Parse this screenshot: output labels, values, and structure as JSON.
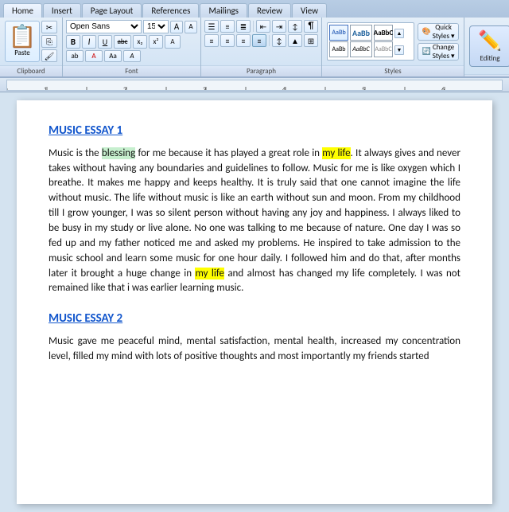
{
  "tabs": [
    {
      "label": "Home"
    },
    {
      "label": "Insert"
    },
    {
      "label": "Page Layout"
    },
    {
      "label": "References"
    },
    {
      "label": "Mailings"
    },
    {
      "label": "Review"
    },
    {
      "label": "View"
    }
  ],
  "font": {
    "name": "Open Sans",
    "size": "15",
    "bold": "B",
    "italic": "I",
    "underline": "U",
    "strikethrough": "abc",
    "subscript": "x₂",
    "superscript": "x²",
    "grow": "A",
    "shrink": "A",
    "clear": "A",
    "case": "Aa",
    "highlight": "A"
  },
  "groups": {
    "clipboard": "Clipboard",
    "font": "Font",
    "paragraph": "Paragraph",
    "styles": "Styles",
    "editing": "Editing"
  },
  "styles": {
    "quick_label": "Quick\nStyles ▾",
    "change_label": "Change\nStyles ▾"
  },
  "editing": {
    "label": "Editing"
  },
  "essay1": {
    "title": "MUSIC ESSAY 1",
    "body": "Music is the blessing for me because it has played a great role in my life. It always gives and never takes without having any boundaries and guidelines to follow. Music for me is like oxygen which I breathe. It makes me happy and keeps healthy. It is truly said that one cannot imagine the life without music. The life without music is like an earth without sun and moon. From my childhood till I grow younger, I was so silent person without having any joy and happiness. I always liked to be busy in my study or live alone. No one was talking to me because of nature. One day I was so fed up and my father noticed me and asked my problems. He inspired to take admission to the music school and learn some music for one hour daily. I followed him and do that, after months later it brought a huge change in my life and almost has changed my life completely. I was not remained like that i was earlier learning music."
  },
  "essay2": {
    "title": "MUSIC ESSAY 2",
    "body": "Music gave me peaceful mind, mental satisfaction, mental health, increased my concentration level, filled my mind with lots of positive thoughts and most importantly my friends started"
  }
}
